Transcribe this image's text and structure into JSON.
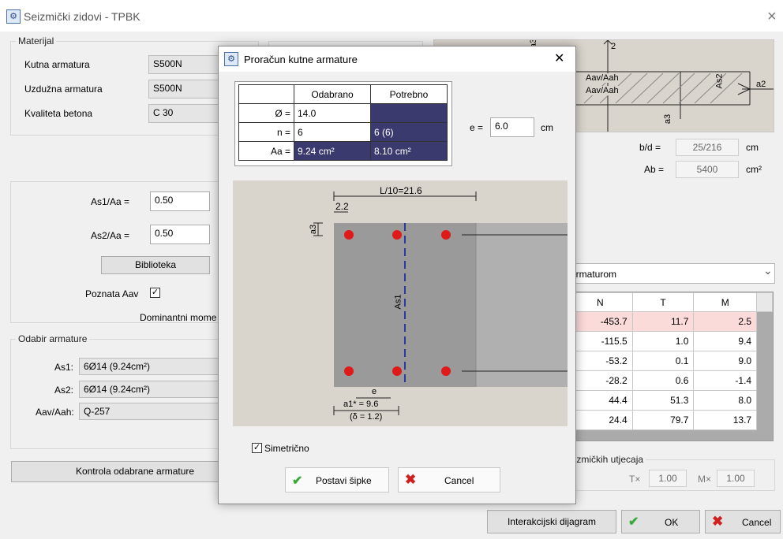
{
  "window": {
    "title": "Seizmički zidovi - TPBK",
    "close_icon": "×"
  },
  "materijal": {
    "legend": "Materijal",
    "rows": [
      {
        "label": "Kutna armatura",
        "value": "S500N"
      },
      {
        "label": "Uzdužna armatura",
        "value": "S500N"
      },
      {
        "label": "Kvaliteta betona",
        "value": "C 30"
      }
    ]
  },
  "section_top": {
    "label_2": "2",
    "label_aav1": "Aav/Aah",
    "label_aav2": "Aav/Aah",
    "label_as2": "As2",
    "label_a2": "a2",
    "label_a3": "a3",
    "label_top": "a3",
    "bd_label": "b/d =",
    "bd_value": "25/216",
    "bd_unit": "cm",
    "ab_label": "Ab =",
    "ab_value": "5400",
    "ab_unit": "cm²"
  },
  "ratios": {
    "as1_label": "As1/Aa =",
    "as1_value": "0.50",
    "as2_label": "As2/Aa =",
    "as2_value": "0.50",
    "library_button": "Biblioteka",
    "poznata_label": "Poznata Aav",
    "poznata_check": "✓",
    "dominant_label": "Dominantni mome"
  },
  "odabir": {
    "legend": "Odabir armature",
    "rows": [
      {
        "label": "As1:",
        "value": "6Ø14 (9.24cm²)"
      },
      {
        "label": "As2:",
        "value": "6Ø14 (9.24cm²)"
      },
      {
        "label": "Aav/Aah:",
        "value": "Q-257"
      }
    ]
  },
  "kontrola_button": "Kontrola odabrane armature",
  "dropdown": {
    "value": "armaturom",
    "chevron": "⌄"
  },
  "forces_table": {
    "headers": [
      "N",
      "T",
      "M"
    ],
    "rows": [
      [
        "-453.7",
        "11.7",
        "2.5"
      ],
      [
        "-115.5",
        "1.0",
        "9.4"
      ],
      [
        "-53.2",
        "0.1",
        "9.0"
      ],
      [
        "-28.2",
        "0.6",
        "-1.4"
      ],
      [
        "44.4",
        "51.3",
        "8.0"
      ],
      [
        "24.4",
        "79.7",
        "13.7"
      ]
    ]
  },
  "seismic": {
    "legend": "eizmičkih utjecaja",
    "tx_label": "T×",
    "tx_value": "1.00",
    "mx_label": "M×",
    "mx_value": "1.00"
  },
  "bottom": {
    "interakcijski": "Interakcijski dijagram",
    "ok": "OK",
    "cancel": "Cancel"
  },
  "dialog": {
    "title": "Proračun kutne armature",
    "close": "✕",
    "table": {
      "col1": "Odabrano",
      "col2": "Potrebno",
      "rows": [
        {
          "label": "Ø =",
          "sel": "14.0",
          "req": ""
        },
        {
          "label": "n =",
          "sel": "6",
          "req": "6 (6)"
        },
        {
          "label": "Aa =",
          "sel": "9.24 cm²",
          "req": "8.10 cm²"
        }
      ]
    },
    "e_label": "e =",
    "e_value": "6.0",
    "e_unit": "cm",
    "drawing": {
      "l10": "L/10=21.6",
      "d22": "2.2",
      "a3": "a3",
      "as1": "As1",
      "e": "e",
      "a1": "a1* = 9.6",
      "delta": "(δ = 1.2)"
    },
    "symmetric_label": "Simetrično",
    "symmetric_check": "✓",
    "postavi": "Postavi šipke",
    "cancel": "Cancel"
  },
  "icons": {
    "app": "app-icon",
    "check": "check-icon",
    "x": "x-icon",
    "close": "close-icon"
  }
}
